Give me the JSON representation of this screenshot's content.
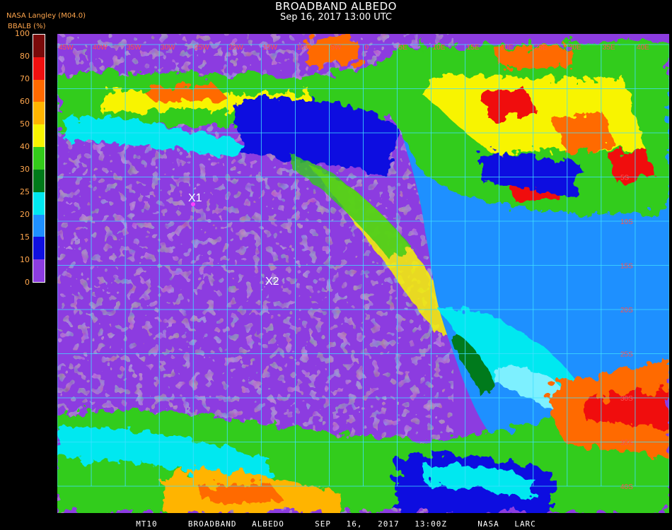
{
  "header": {
    "title": "BROADBAND ALBEDO",
    "subtitle": "Sep 16, 2017 13:00 UTC",
    "source": "NASA Langley (M04.0)"
  },
  "colorbar": {
    "label": "BBALB (%)",
    "ticks": [
      "100",
      "80",
      "70",
      "60",
      "50",
      "40",
      "30",
      "25",
      "20",
      "15",
      "10",
      "0"
    ],
    "segments": [
      {
        "from": 0,
        "to": 10,
        "color": "#8c3ce0"
      },
      {
        "from": 10,
        "to": 15,
        "color": "#1010e0"
      },
      {
        "from": 15,
        "to": 20,
        "color": "#1e90ff"
      },
      {
        "from": 20,
        "to": 25,
        "color": "#00e8f0"
      },
      {
        "from": 25,
        "to": 30,
        "color": "#007a1a"
      },
      {
        "from": 30,
        "to": 40,
        "color": "#33cc1a"
      },
      {
        "from": 40,
        "to": 50,
        "color": "#f8f400"
      },
      {
        "from": 50,
        "to": 60,
        "color": "#ffb400"
      },
      {
        "from": 60,
        "to": 70,
        "color": "#ff6a00"
      },
      {
        "from": 70,
        "to": 80,
        "color": "#f01010"
      },
      {
        "from": 80,
        "to": 100,
        "color": "#7a0a0a"
      }
    ]
  },
  "map": {
    "longitude_labels": [
      "45W",
      "40W",
      "35W",
      "30W",
      "25W",
      "20W",
      "15W",
      "10W",
      "5W",
      "0",
      "5E",
      "10E",
      "15E",
      "20E",
      "25E",
      "30E",
      "35E",
      "40E",
      "45E"
    ],
    "latitude_labels": [
      "5S",
      "10S",
      "15S",
      "20S",
      "25S",
      "30S",
      "35S",
      "40S"
    ],
    "markers": [
      {
        "label": "X1",
        "color": "#ff40ff"
      },
      {
        "label": "X2",
        "color": "#ffffff"
      }
    ],
    "colors": {
      "ocean": "#8c3ce0",
      "grid": "#40e0ff"
    }
  },
  "footer": "MT10  BROADBAND ALBEDO  SEP 16, 2017 13:00Z  NASA LARC"
}
